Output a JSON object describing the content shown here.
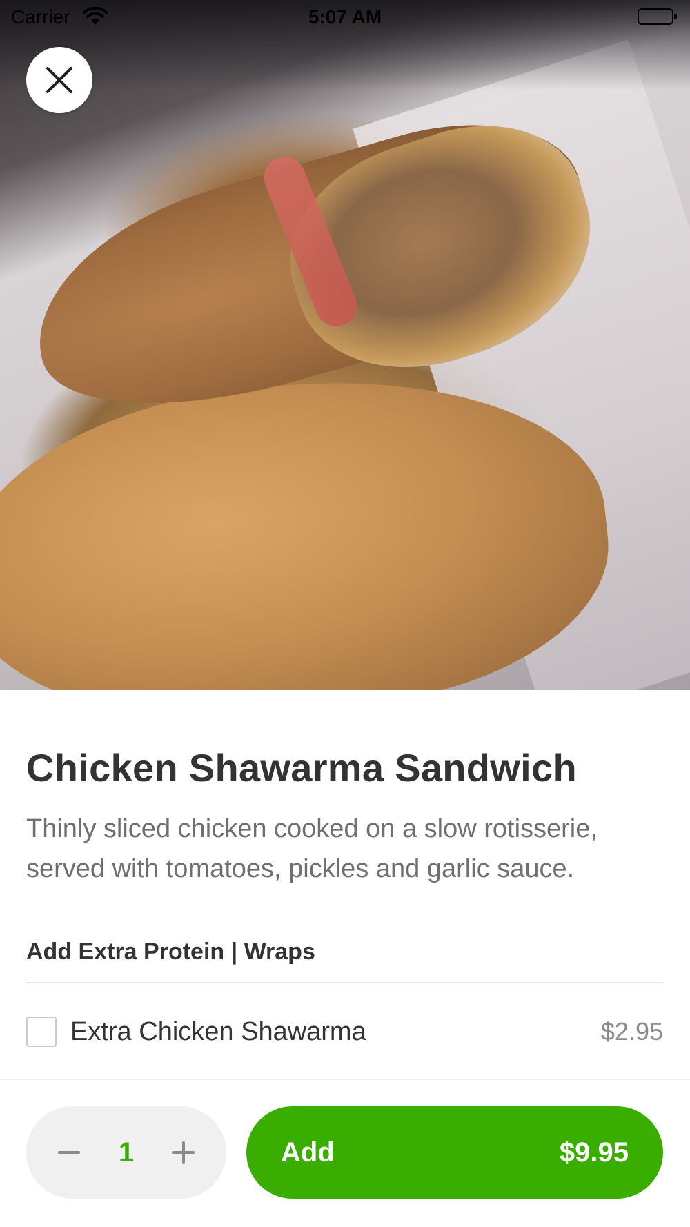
{
  "status_bar": {
    "carrier": "Carrier",
    "time": "5:07 AM"
  },
  "hero": {
    "image_alt": "Chicken shawarma wrap photo"
  },
  "item": {
    "title": "Chicken Shawarma Sandwich",
    "description": "Thinly sliced chicken cooked on a slow rotisserie, served with tomatoes, pickles and garlic sauce."
  },
  "options_section": {
    "heading": "Add Extra Protein | Wraps",
    "options": [
      {
        "label": "Extra Chicken Shawarma",
        "price": "$2.95",
        "checked": false
      }
    ]
  },
  "footer": {
    "quantity": "1",
    "add_label": "Add",
    "total_price": "$9.95"
  },
  "colors": {
    "accent": "#3aae00",
    "stepper_bg": "#f0f0f0",
    "text_primary": "#333333",
    "text_secondary": "#6f6f6f"
  },
  "icons": {
    "close": "close-icon",
    "minus": "minus-icon",
    "plus": "plus-icon",
    "wifi": "wifi-icon",
    "battery": "battery-icon"
  }
}
